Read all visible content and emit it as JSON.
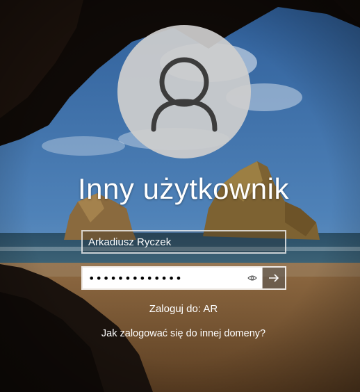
{
  "login": {
    "display_name": "Inny użytkownik",
    "username_value": "Arkadiusz Ryczek",
    "password_value": "•••••••••••••",
    "sign_in_to": "Zaloguj do: AR",
    "other_domain_link": "Jak zalogować się do innej domeny?"
  },
  "icons": {
    "avatar": "user-silhouette-icon",
    "reveal": "eye-icon",
    "submit": "arrow-right-icon"
  },
  "colors": {
    "text": "#ffffff",
    "avatar_bg": "#cdcdcd",
    "avatar_glyph": "#3c3c3c",
    "password_bg": "#ffffff"
  }
}
